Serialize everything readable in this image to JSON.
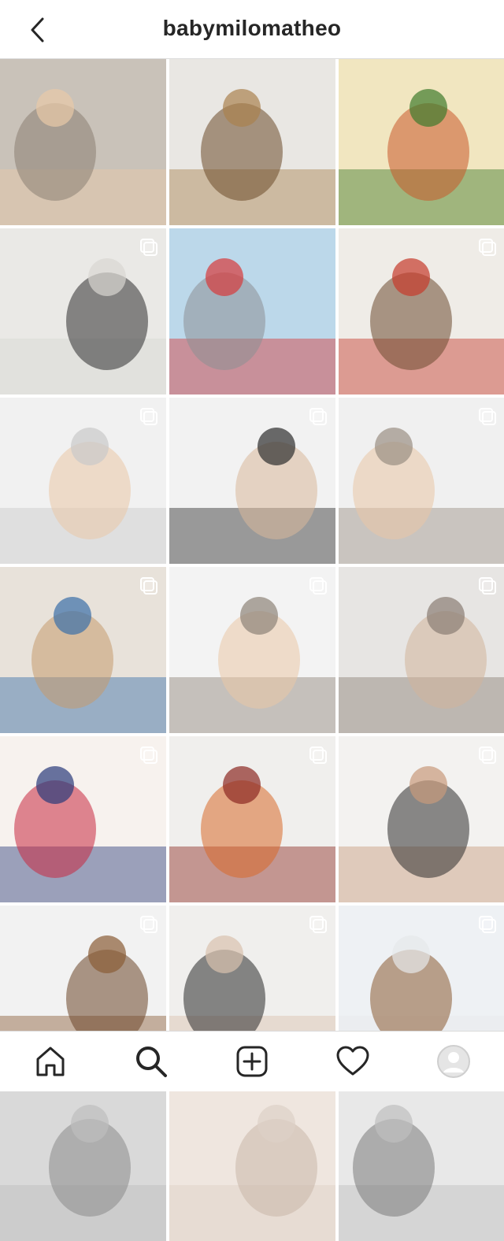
{
  "header": {
    "username": "babymilomatheo"
  },
  "grid": {
    "rows": [
      [
        {
          "multi": false,
          "palette": [
            "#c9c2b9",
            "#8b7f73",
            "#e8c9a8"
          ]
        },
        {
          "multi": false,
          "palette": [
            "#e9e7e3",
            "#6b4a2a",
            "#a9824f"
          ]
        },
        {
          "multi": false,
          "palette": [
            "#f1e6c0",
            "#c8572a",
            "#3f7b2c"
          ]
        }
      ],
      [
        {
          "multi": true,
          "palette": [
            "#eae9e6",
            "#2d2d2d",
            "#d8d6d2"
          ]
        },
        {
          "multi": false,
          "palette": [
            "#bcd8ea",
            "#8c8f93",
            "#d73a3a"
          ]
        },
        {
          "multi": true,
          "palette": [
            "#efece7",
            "#6b4a2f",
            "#c63a2b"
          ]
        }
      ],
      [
        {
          "multi": true,
          "palette": [
            "#f1f1f1",
            "#e9c7a5",
            "#c9c9c9"
          ]
        },
        {
          "multi": true,
          "palette": [
            "#f2f2f2",
            "#d8b89a",
            "#2d2d2d"
          ]
        },
        {
          "multi": true,
          "palette": [
            "#f0f0f0",
            "#e9c7a5",
            "#9a8f83"
          ]
        }
      ],
      [
        {
          "multi": true,
          "palette": [
            "#e8e2da",
            "#c49b6e",
            "#3a6fa8"
          ]
        },
        {
          "multi": true,
          "palette": [
            "#f3f3f3",
            "#e9c7a5",
            "#8d8378"
          ]
        },
        {
          "multi": true,
          "palette": [
            "#e7e5e3",
            "#d2b49a",
            "#8a7e74"
          ]
        }
      ],
      [
        {
          "multi": true,
          "palette": [
            "#f7f2ee",
            "#c8283f",
            "#2a3b7a"
          ]
        },
        {
          "multi": true,
          "palette": [
            "#f0efed",
            "#d96a2a",
            "#8c2a22"
          ]
        },
        {
          "multi": true,
          "palette": [
            "#f3f2f0",
            "#2e2e2e",
            "#c79a7a"
          ]
        }
      ],
      [
        {
          "multi": true,
          "palette": [
            "#f2f2f2",
            "#6b4628",
            "#8a5c36"
          ]
        },
        {
          "multi": true,
          "palette": [
            "#f0efed",
            "#2a2a2a",
            "#d9c2ae"
          ]
        },
        {
          "multi": true,
          "palette": [
            "#eef1f4",
            "#8b5a32",
            "#e6e8ea"
          ]
        }
      ],
      [
        {
          "multi": false,
          "palette": [
            "#d9d9d9",
            "#8a8a8a",
            "#bdbdbd"
          ]
        },
        {
          "multi": false,
          "palette": [
            "#efe6df",
            "#c8b7a8",
            "#ddd0c6"
          ]
        },
        {
          "multi": false,
          "palette": [
            "#e8e8e8",
            "#7a7a7a",
            "#bfbfbf"
          ]
        }
      ]
    ]
  },
  "nav": {
    "items": [
      {
        "name": "home"
      },
      {
        "name": "search"
      },
      {
        "name": "new-post"
      },
      {
        "name": "activity"
      },
      {
        "name": "profile"
      }
    ]
  }
}
